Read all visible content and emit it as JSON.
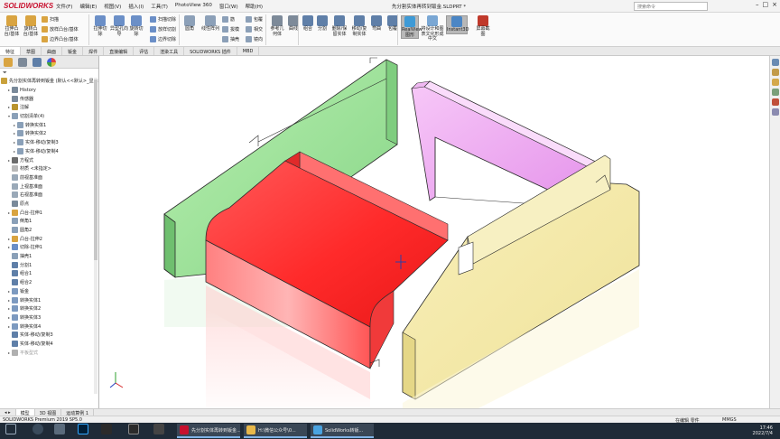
{
  "app": {
    "logo": "SOLIDWORKS",
    "menus": [
      "文件(F)",
      "编辑(E)",
      "视图(V)",
      "插入(I)",
      "工具(T)",
      "PhotoView 360",
      "窗口(W)",
      "帮助(H)"
    ],
    "document_title": "先分割实体再转到钣金.SLDPRT *",
    "search_placeholder": "搜索命令",
    "window_controls": [
      "–",
      "□",
      "×"
    ]
  },
  "ribbon": {
    "big_buttons": [
      {
        "label": "拉伸凸台/基体",
        "color": "#d9a441"
      },
      {
        "label": "旋转凸台/基体",
        "color": "#d9a441"
      },
      {
        "label": "拉伸切除",
        "color": "#6b8fc7"
      },
      {
        "label": "异型孔向导",
        "color": "#6b8fc7"
      },
      {
        "label": "旋转切除",
        "color": "#6b8fc7"
      },
      {
        "label": "圆角",
        "color": "#8ca0b8"
      },
      {
        "label": "线性阵列",
        "color": "#8ca0b8"
      },
      {
        "label": "参考几何体",
        "color": "#7d8a99"
      },
      {
        "label": "曲线",
        "color": "#7d8a99"
      },
      {
        "label": "组合",
        "color": "#5f7fa8"
      },
      {
        "label": "分割",
        "color": "#5f7fa8"
      },
      {
        "label": "删除/保留实体",
        "color": "#5f7fa8"
      },
      {
        "label": "移动/复制实体",
        "color": "#5f7fa8"
      },
      {
        "label": "弯曲",
        "color": "#5f7fa8"
      },
      {
        "label": "包覆",
        "color": "#5f7fa8"
      },
      {
        "label": "RealView 图形",
        "color": "#3e9ad6"
      },
      {
        "label": "将设计和图表文化形成中文",
        "color": "#7aa7d4"
      },
      {
        "label": "Instant3D",
        "color": "#4b86c5"
      },
      {
        "label": "屏幕截图",
        "color": "#c0392b"
      }
    ],
    "small_buttons": [
      {
        "label": "扫描",
        "color": "#d9a441"
      },
      {
        "label": "放样凸台/基体",
        "color": "#d9a441"
      },
      {
        "label": "边界凸台/基体",
        "color": "#d9a441"
      },
      {
        "label": "扫描切除",
        "color": "#6b8fc7"
      },
      {
        "label": "放样切割",
        "color": "#6b8fc7"
      },
      {
        "label": "边界切除",
        "color": "#6b8fc7"
      },
      {
        "label": "筋",
        "color": "#8ca0b8"
      },
      {
        "label": "拔模",
        "color": "#8ca0b8"
      },
      {
        "label": "抽壳",
        "color": "#8ca0b8"
      },
      {
        "label": "包覆",
        "color": "#8ca0b8"
      },
      {
        "label": "相交",
        "color": "#8ca0b8"
      },
      {
        "label": "镜向",
        "color": "#8ca0b8"
      }
    ]
  },
  "command_tabs": [
    "特征",
    "草图",
    "曲面",
    "钣金",
    "焊件",
    "直接编辑",
    "评估",
    "渲染工具",
    "SOLIDWORKS 插件",
    "MBD"
  ],
  "feature_tree": {
    "tab_icons": [
      "feature-manager-icon",
      "property-manager-icon",
      "configuration-manager-icon",
      "display-manager-icon"
    ],
    "filter_icon": "filter-icon",
    "rows": [
      {
        "label": "先分割实体再转到钣金 (默认<<默认>_显示状态 1>)",
        "indent": 0,
        "exp": "",
        "color": "#c9a13b",
        "grey": false
      },
      {
        "label": "History",
        "indent": 1,
        "exp": "▸",
        "color": "#7a8a9a",
        "grey": false
      },
      {
        "label": "传感器",
        "indent": 1,
        "exp": "",
        "color": "#7a8a9a",
        "grey": false
      },
      {
        "label": "注解",
        "indent": 1,
        "exp": "▸",
        "color": "#b9942e",
        "grey": false
      },
      {
        "label": "切割清单(4)",
        "indent": 1,
        "exp": "▾",
        "color": "#8aa0b8",
        "grey": false
      },
      {
        "label": "转换实体1",
        "indent": 2,
        "exp": "▸",
        "color": "#8aa0b8",
        "grey": false
      },
      {
        "label": "转换实体2",
        "indent": 2,
        "exp": "▸",
        "color": "#8aa0b8",
        "grey": false
      },
      {
        "label": "实体-移动/复制3",
        "indent": 2,
        "exp": "▸",
        "color": "#8aa0b8",
        "grey": false
      },
      {
        "label": "实体-移动/复制4",
        "indent": 2,
        "exp": "▸",
        "color": "#8aa0b8",
        "grey": false
      },
      {
        "label": "方程式",
        "indent": 1,
        "exp": "▸",
        "color": "#6c6c6c",
        "grey": false
      },
      {
        "label": "材质 <未指定>",
        "indent": 1,
        "exp": "",
        "color": "#b8b8b8",
        "grey": false
      },
      {
        "label": "前视基准面",
        "indent": 1,
        "exp": "",
        "color": "#9aa9b8",
        "grey": false
      },
      {
        "label": "上视基准面",
        "indent": 1,
        "exp": "",
        "color": "#9aa9b8",
        "grey": false
      },
      {
        "label": "右视基准面",
        "indent": 1,
        "exp": "",
        "color": "#9aa9b8",
        "grey": false
      },
      {
        "label": "原点",
        "indent": 1,
        "exp": "",
        "color": "#7a8a9a",
        "grey": false
      },
      {
        "label": "凸台-拉伸1",
        "indent": 1,
        "exp": "▸",
        "color": "#d9a441",
        "grey": false
      },
      {
        "label": "倒角1",
        "indent": 1,
        "exp": "",
        "color": "#8aa0b8",
        "grey": false
      },
      {
        "label": "圆角2",
        "indent": 1,
        "exp": "",
        "color": "#8aa0b8",
        "grey": false
      },
      {
        "label": "凸台-拉伸2",
        "indent": 1,
        "exp": "▸",
        "color": "#d9a441",
        "grey": false
      },
      {
        "label": "切除-拉伸1",
        "indent": 1,
        "exp": "▸",
        "color": "#6b8fc7",
        "grey": false
      },
      {
        "label": "抽壳1",
        "indent": 1,
        "exp": "",
        "color": "#8aa0b8",
        "grey": false
      },
      {
        "label": "分割1",
        "indent": 1,
        "exp": "",
        "color": "#5f7fa8",
        "grey": false
      },
      {
        "label": "组合1",
        "indent": 1,
        "exp": "",
        "color": "#5f7fa8",
        "grey": false
      },
      {
        "label": "组合2",
        "indent": 1,
        "exp": "",
        "color": "#5f7fa8",
        "grey": false
      },
      {
        "label": "钣金",
        "indent": 1,
        "exp": "▸",
        "color": "#7d9ac0",
        "grey": false
      },
      {
        "label": "转换实体1",
        "indent": 1,
        "exp": "▸",
        "color": "#7d9ac0",
        "grey": false
      },
      {
        "label": "转换实体2",
        "indent": 1,
        "exp": "▸",
        "color": "#7d9ac0",
        "grey": false
      },
      {
        "label": "转换实体3",
        "indent": 1,
        "exp": "▸",
        "color": "#7d9ac0",
        "grey": false
      },
      {
        "label": "转换实体4",
        "indent": 1,
        "exp": "▸",
        "color": "#7d9ac0",
        "grey": false
      },
      {
        "label": "实体-移动/复制3",
        "indent": 1,
        "exp": "",
        "color": "#5f7fa8",
        "grey": false
      },
      {
        "label": "实体-移动/复制4",
        "indent": 1,
        "exp": "",
        "color": "#5f7fa8",
        "grey": false
      },
      {
        "label": "平板型式",
        "indent": 1,
        "exp": "▸",
        "color": "#b0b0b0",
        "grey": true
      }
    ]
  },
  "viewport": {
    "parts": [
      {
        "name": "green-panel",
        "color": "#9be39b"
      },
      {
        "name": "pink-panel",
        "color": "#f2a8f5"
      },
      {
        "name": "red-cover",
        "color": "#ff3a3a"
      },
      {
        "name": "yellow-panel",
        "color": "#f5ecaa"
      }
    ],
    "triad_icon": "coordinate-triad-icon",
    "origin_icon": "origin-icon"
  },
  "taskpane_icons": [
    {
      "name": "resources-icon",
      "color": "#6a8bb3"
    },
    {
      "name": "design-library-icon",
      "color": "#c29b4a"
    },
    {
      "name": "file-explorer-icon",
      "color": "#d4a84a"
    },
    {
      "name": "view-palette-icon",
      "color": "#7aa07a"
    },
    {
      "name": "appearances-icon",
      "color": "#c0503a"
    },
    {
      "name": "custom-properties-icon",
      "color": "#8b8bb0"
    }
  ],
  "bottom_tabs": [
    "模型",
    "3D 视图",
    "运动算例 1"
  ],
  "status": {
    "left": "SOLIDWORKS Premium 2019 SP5.0",
    "editing": "在编辑 零件",
    "units": "MMGS"
  },
  "taskbar": {
    "apps": [
      {
        "label": "先分割实体再转到钣金... (SOLIDWORKS P...",
        "color": "#c8102e"
      },
      {
        "label": "H:\\微信公众号\\0...",
        "color": "#e8b84a"
      },
      {
        "label": "SolidWorks转钣...",
        "color": "#4aa3e0"
      }
    ],
    "time": "17:46",
    "date": "2022/7/4"
  }
}
